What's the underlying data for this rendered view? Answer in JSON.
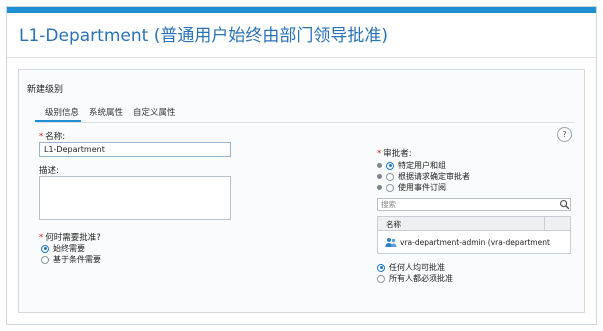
{
  "page": {
    "title": "L1-Department (普通用户始终由部门领导批准)"
  },
  "panel": {
    "title": "新建级别",
    "tabs": [
      "级别信息",
      "系统属性",
      "自定义属性"
    ]
  },
  "form": {
    "name_label": "名称:",
    "name_value": "L1-Department",
    "description_label": "描述:",
    "when_label": "何时需要批准?",
    "when_options": [
      {
        "label": "始终需要",
        "selected": true
      },
      {
        "label": "基于条件需要",
        "selected": false
      }
    ],
    "approver_label": "审批者:",
    "approver_options": [
      {
        "label": "特定用户和组",
        "selected": true
      },
      {
        "label": "根据请求确定审批者",
        "selected": false
      },
      {
        "label": "使用事件订阅",
        "selected": false
      }
    ],
    "search_placeholder": "搜索",
    "table_header": "名称",
    "table_rows": [
      "vra-department-admin (vra-department"
    ],
    "approval_mode_options": [
      {
        "label": "任何人均可批准",
        "selected": true
      },
      {
        "label": "所有人都必须批准",
        "selected": false
      }
    ],
    "help_label": "?"
  },
  "icons": {
    "search": "search-icon",
    "user_group": "user-group-icon",
    "help": "help-icon"
  },
  "colors": {
    "accent": "#1e8fd3",
    "title": "#2a72b8"
  }
}
